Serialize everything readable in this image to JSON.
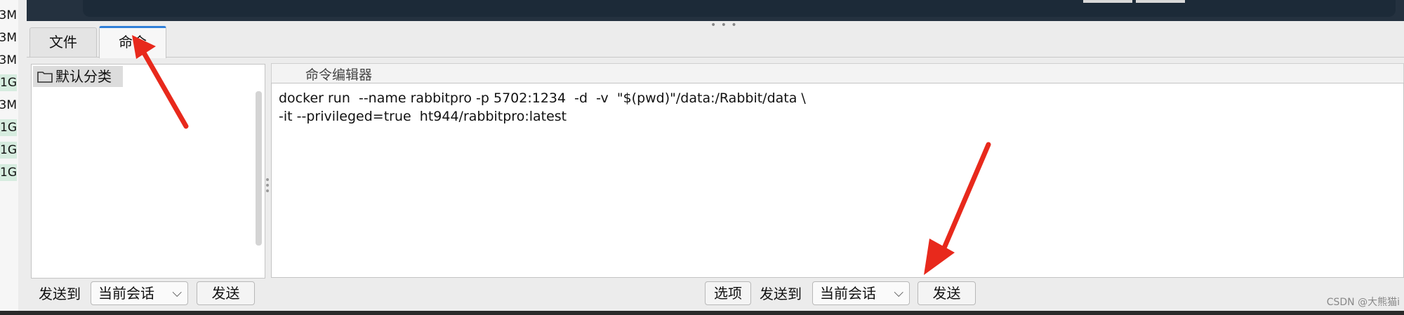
{
  "file_sizes": [
    "3M",
    "3M",
    "3M",
    "1G",
    "3M",
    "1G",
    "1G",
    "1G"
  ],
  "tabs": [
    {
      "label": "文件",
      "active": false
    },
    {
      "label": "命令",
      "active": true
    }
  ],
  "category_panel": {
    "folder_icon": "folder-icon",
    "header": "默认分类"
  },
  "editor": {
    "title": "命令编辑器",
    "content": "docker run  --name rabbitpro -p 5702:1234  -d  -v  \"$(pwd)\"/data:/Rabbit/data \\\n-it --privileged=true  ht944/rabbitpro:latest"
  },
  "left_bottom": {
    "send_to_label": "发送到",
    "target_select": "当前会话",
    "send_button": "发送"
  },
  "right_bottom": {
    "options_button": "选项",
    "send_to_label": "发送到",
    "target_select": "当前会话",
    "send_button": "发送"
  },
  "watermark": "CSDN @大熊猫i",
  "colors": {
    "accent": "#2f7fd8",
    "annotation_arrow": "#e8291c",
    "terminal_bg": "#24313f"
  }
}
